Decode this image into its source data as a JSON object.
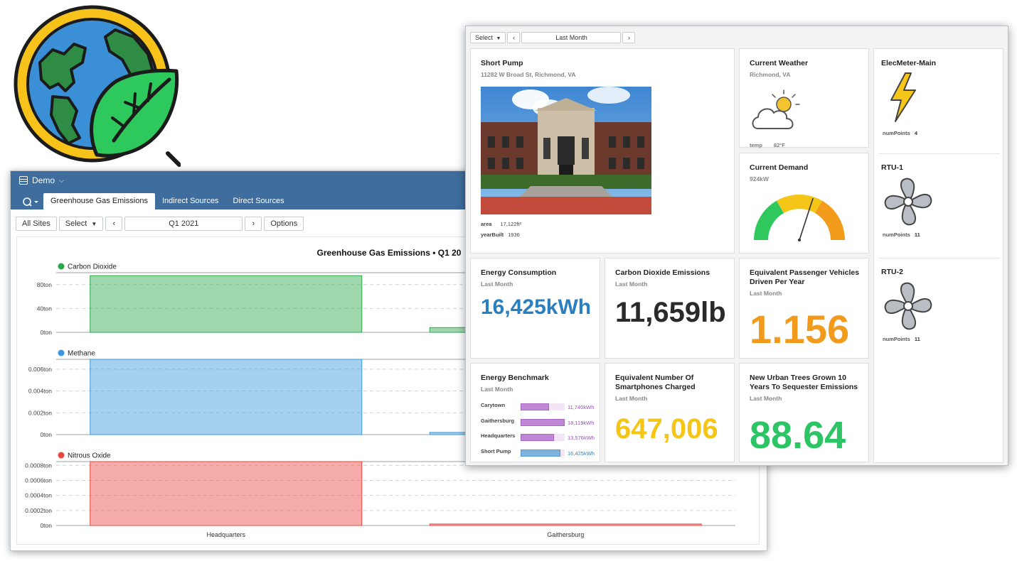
{
  "logo": {
    "icon": "earth-leaf-icon"
  },
  "back_window": {
    "app_name": "Demo",
    "tabs": [
      {
        "label": "Greenhouse Gas Emissions",
        "active": true
      },
      {
        "label": "Indirect Sources",
        "active": false
      },
      {
        "label": "Direct Sources",
        "active": false
      }
    ],
    "toolbar": {
      "all_sites": "All Sites",
      "select": "Select",
      "period": "Q1 2021",
      "options": "Options"
    },
    "chart_title": "Greenhouse Gas Emissions • Q1 20"
  },
  "chart_data": [
    {
      "type": "bar",
      "title": "Greenhouse Gas Emissions • Q1 20",
      "series": [
        {
          "name": "Carbon Dioxide",
          "values": [
            95,
            8
          ]
        }
      ],
      "categories": [
        "Headquarters",
        "Gaithersburg"
      ],
      "yticks": [
        {
          "value": 0,
          "label": "0ton"
        },
        {
          "value": 40,
          "label": "40ton"
        },
        {
          "value": 80,
          "label": "80ton"
        }
      ],
      "ylim": [
        0,
        100
      ],
      "color": "#2aa84a"
    },
    {
      "type": "bar",
      "series": [
        {
          "name": "Methane",
          "values": [
            0.0069,
            0.0002
          ]
        }
      ],
      "categories": [
        "Headquarters",
        "Gaithersburg"
      ],
      "yticks": [
        {
          "value": 0,
          "label": "0ton"
        },
        {
          "value": 0.002,
          "label": "0.002ton"
        },
        {
          "value": 0.004,
          "label": "0.004ton"
        },
        {
          "value": 0.006,
          "label": "0.006ton"
        }
      ],
      "ylim": [
        0,
        0.0069
      ],
      "color": "#3a97dd"
    },
    {
      "type": "bar",
      "series": [
        {
          "name": "Nitrous Oxide",
          "values": [
            0.00085,
            2e-05
          ]
        }
      ],
      "categories": [
        "Headquarters",
        "Gaithersburg"
      ],
      "yticks": [
        {
          "value": 0,
          "label": "0ton"
        },
        {
          "value": 0.0002,
          "label": "0.0002ton"
        },
        {
          "value": 0.0004,
          "label": "0.0004ton"
        },
        {
          "value": 0.0006,
          "label": "0.0006ton"
        },
        {
          "value": 0.0008,
          "label": "0.0008ton"
        }
      ],
      "ylim": [
        0,
        0.00085
      ],
      "color": "#e8473e"
    }
  ],
  "front_window": {
    "toolbar": {
      "select": "Select",
      "period": "Last Month"
    },
    "site": {
      "title": "Short Pump",
      "address": "11282 W Broad St, Richmond, VA",
      "props": [
        {
          "key": "area",
          "value": "17,122ft²"
        },
        {
          "key": "yearBuilt",
          "value": "1936"
        }
      ]
    },
    "weather": {
      "title": "Current Weather",
      "location": "Richmond, VA",
      "icon": "partly-cloudy-icon",
      "prop_key": "temp",
      "prop_value": "82°F"
    },
    "demand": {
      "title": "Current Demand",
      "value": "924kW",
      "gauge_fraction": 0.6
    },
    "energy": {
      "title": "Energy Consumption",
      "sub": "Last Month",
      "value": "16,425kWh",
      "color": "#2a7fc1"
    },
    "co2": {
      "title": "Carbon Dioxide Emissions",
      "sub": "Last Month",
      "value": "11,659lb",
      "color": "#2a2a2a"
    },
    "vehicles": {
      "title": "Equivalent Passenger Vehicles Driven Per Year",
      "sub": "Last Month",
      "value": "1.156",
      "color": "#f29a1b"
    },
    "benchmark": {
      "title": "Energy Benchmark",
      "sub": "Last Month",
      "max": 18119,
      "rows": [
        {
          "name": "Carytown",
          "value": 11740,
          "label": "11,740kWh",
          "color": "#bf87d6"
        },
        {
          "name": "Gaithersburg",
          "value": 18119,
          "label": "18,119kWh",
          "color": "#bf87d6"
        },
        {
          "name": "Headquarters",
          "value": 13576,
          "label": "13,576kWh",
          "color": "#bf87d6"
        },
        {
          "name": "Short Pump",
          "value": 16425,
          "label": "16,425kWh",
          "color": "#7eb3dd"
        }
      ]
    },
    "phones": {
      "title": "Equivalent Number Of Smartphones Charged",
      "sub": "Last Month",
      "value": "647,006",
      "color": "#f5c518"
    },
    "trees": {
      "title": "New Urban Trees Grown 10 Years To Sequester Emissions",
      "sub": "Last Month",
      "value": "88.64",
      "color": "#2dc466"
    },
    "equipment": [
      {
        "title": "ElecMeter-Main",
        "icon": "lightning-icon",
        "prop_key": "numPoints",
        "prop_value": "4"
      },
      {
        "title": "RTU-1",
        "icon": "fan-icon",
        "prop_key": "numPoints",
        "prop_value": "11"
      },
      {
        "title": "RTU-2",
        "icon": "fan-icon",
        "prop_key": "numPoints",
        "prop_value": "11"
      }
    ]
  }
}
